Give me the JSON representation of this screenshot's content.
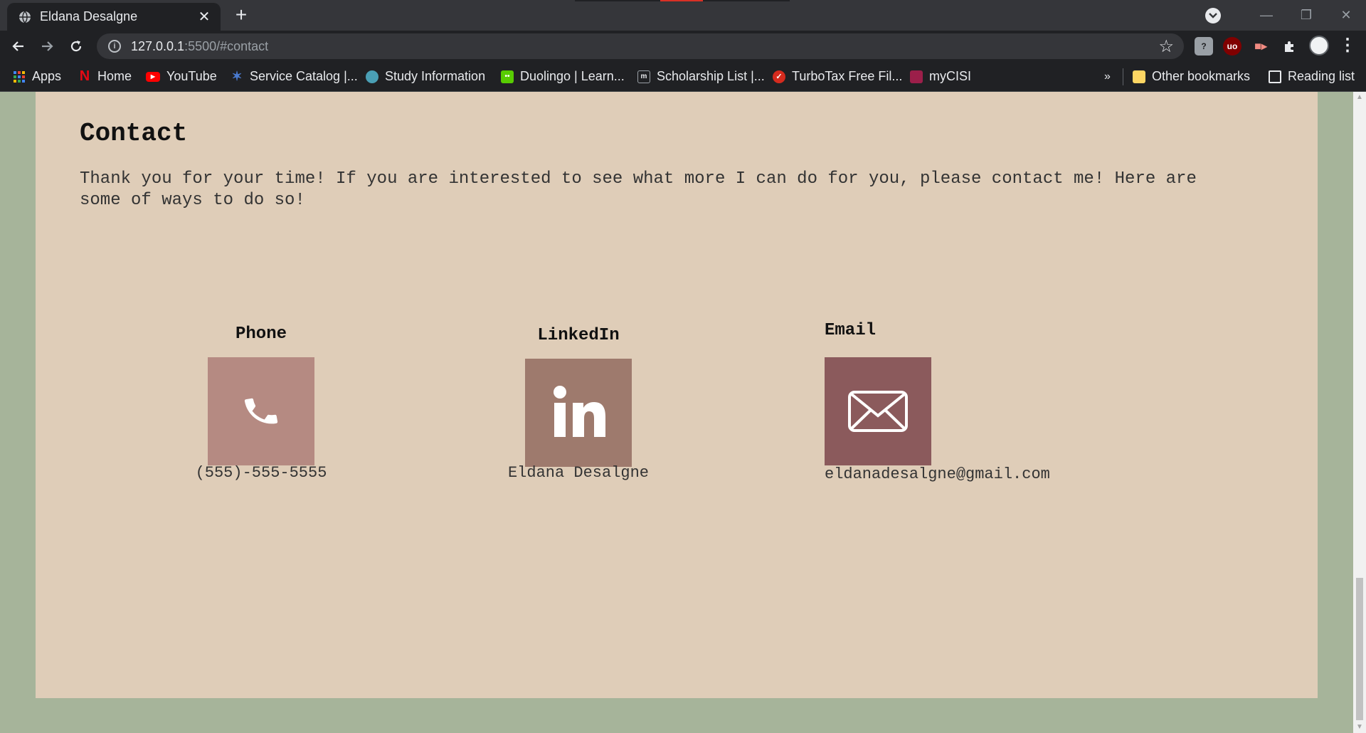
{
  "browser": {
    "tab_title": "Eldana Desalgne",
    "url_host": "127.0.0.1",
    "url_path": ":5500/#contact",
    "bookmarks": [
      {
        "label": "Apps",
        "icon": "apps-grid-icon",
        "color": "#4285f4"
      },
      {
        "label": "Home",
        "icon": "netflix-icon",
        "color": "#e50914"
      },
      {
        "label": "YouTube",
        "icon": "youtube-icon",
        "color": "#ff0000"
      },
      {
        "label": "Service Catalog |...",
        "icon": "service-catalog-icon",
        "color": "#4a7bd0"
      },
      {
        "label": "Study Information",
        "icon": "study-info-icon",
        "color": "#4a9fb5"
      },
      {
        "label": "Duolingo | Learn...",
        "icon": "duolingo-icon",
        "color": "#58cc02"
      },
      {
        "label": "Scholarship List |...",
        "icon": "scholarship-icon",
        "color": "#888888"
      },
      {
        "label": "TurboTax Free Fil...",
        "icon": "turbotax-icon",
        "color": "#d52b1e"
      },
      {
        "label": "myCISI",
        "icon": "mycisi-icon",
        "color": "#9c1f4a"
      }
    ],
    "overflow_label": "»",
    "other_bookmarks": "Other bookmarks",
    "reading_list": "Reading list"
  },
  "page": {
    "heading": "Contact",
    "intro": "Thank you for your time! If you are interested to see what more I can do for you, please contact me! Here are some of ways to do so!",
    "contacts": [
      {
        "label": "Phone",
        "value": "(555)-555-5555",
        "icon": "phone-icon",
        "tile_color": "#b58a82"
      },
      {
        "label": "LinkedIn",
        "value": "Eldana Desalgne",
        "icon": "linkedin-icon",
        "tile_color": "#9e7a6d"
      },
      {
        "label": "Email",
        "value": "eldanadesalgne@gmail.com",
        "icon": "envelope-icon",
        "tile_color": "#8b5a5c"
      }
    ],
    "colors": {
      "page_bg": "#a6b49a",
      "card_bg": "#dfcdb8"
    }
  }
}
